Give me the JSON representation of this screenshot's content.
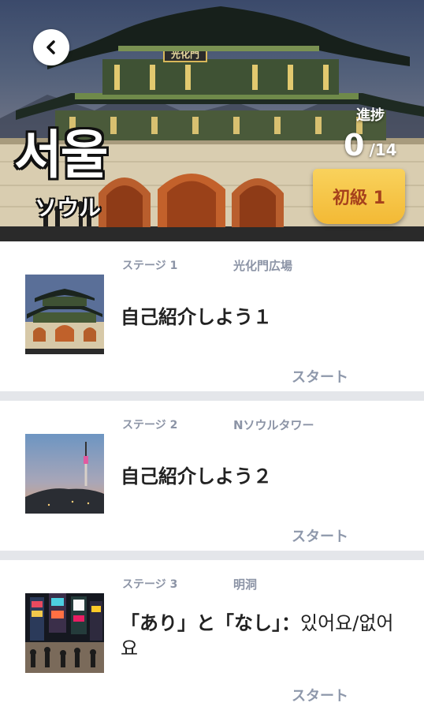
{
  "header": {
    "city_korean": "서울",
    "city_japanese": "ソウル",
    "progress_label": "進捗",
    "progress_current": "0",
    "progress_separator": "/",
    "progress_total": "14",
    "level_badge": "初級 1",
    "sign_text": "光化門"
  },
  "stages": [
    {
      "stage": "ステージ 1",
      "place": "光化門広場",
      "title": "自己紹介しよう１",
      "start": "スタート",
      "thumb": "gwanghwamun-photo"
    },
    {
      "stage": "ステージ 2",
      "place": "Nソウルタワー",
      "title": "自己紹介しよう２",
      "start": "スタート",
      "thumb": "n-seoul-tower-photo"
    },
    {
      "stage": "ステージ 3",
      "place": "明洞",
      "title_bold": "「あり」と「なし」：",
      "title_rest": "있어요/없어요",
      "start": "スタート",
      "thumb": "myeongdong-photo"
    }
  ],
  "colors": {
    "badge": "#f3b935",
    "badge_text": "#a6411c",
    "meta_text": "#8c94a6",
    "divider": "#e4e6ea"
  },
  "icons": {
    "back": "chevron-left-icon"
  }
}
